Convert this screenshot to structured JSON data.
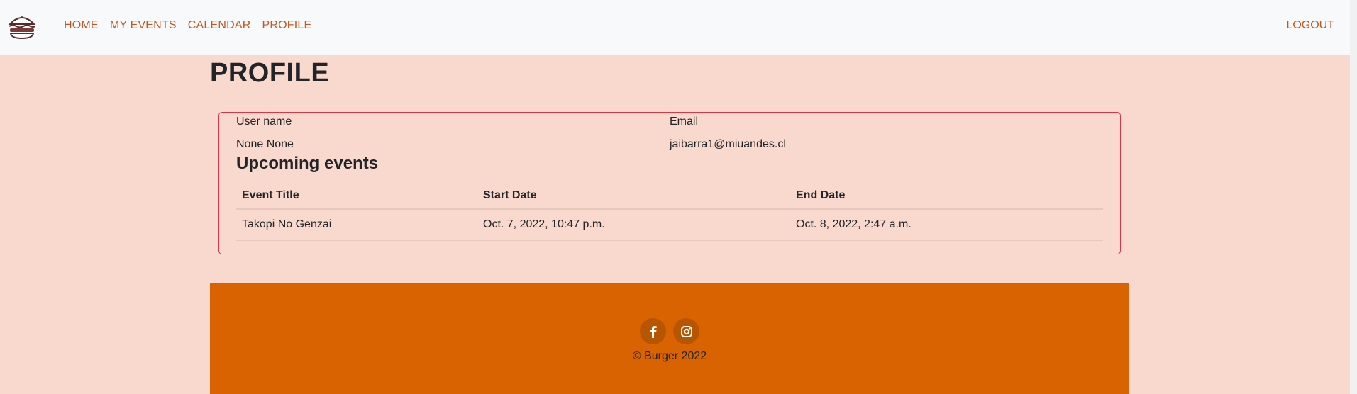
{
  "nav": {
    "logo_alt": "Burger logo",
    "links": [
      "HOME",
      "MY EVENTS",
      "CALENDAR",
      "PROFILE"
    ],
    "logout": "LOGOUT",
    "link_color": "#c8551a"
  },
  "page": {
    "title": "PROFILE",
    "background": "#f9d9cd"
  },
  "profile": {
    "username_label": "User name",
    "username_value": "None None",
    "email_label": "Email",
    "email_value": "jaibarra1@miuandes.cl",
    "card_border_color": "#dc3545"
  },
  "events": {
    "section_title": "Upcoming events",
    "columns": [
      "Event Title",
      "Start Date",
      "End Date"
    ],
    "rows": [
      [
        "Takopi No Genzai",
        "Oct. 7, 2022, 10:47 p.m.",
        "Oct. 8, 2022, 2:47 a.m."
      ]
    ]
  },
  "footer": {
    "icons": [
      "facebook-icon",
      "instagram-icon"
    ],
    "copyright": "© Burger 2022",
    "background": "#d96300"
  }
}
